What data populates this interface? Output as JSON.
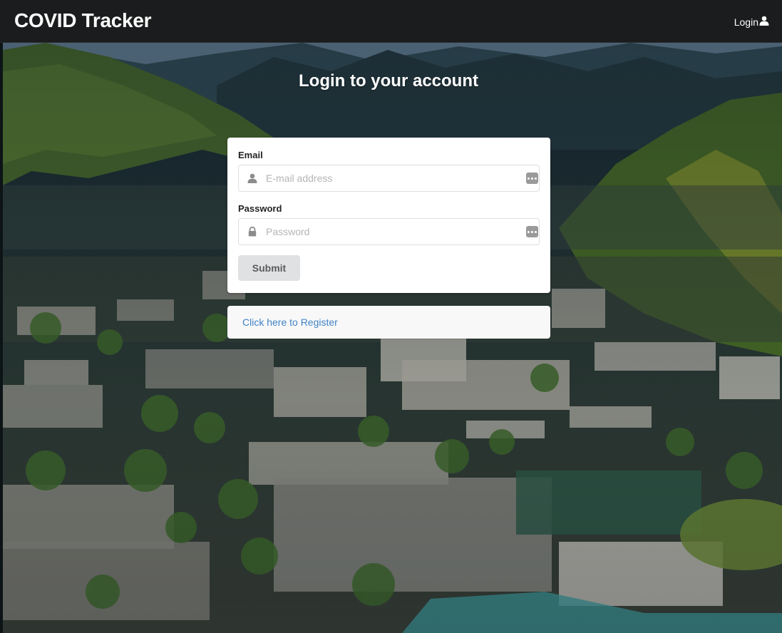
{
  "navbar": {
    "brand": "COVID Tracker",
    "login_label": "Login"
  },
  "page": {
    "title": "Login to your account"
  },
  "form": {
    "email_label": "Email",
    "email_placeholder": "E-mail address",
    "email_value": "",
    "password_label": "Password",
    "password_placeholder": "Password",
    "password_value": "",
    "submit_label": "Submit"
  },
  "register": {
    "link_text": "Click here to Register"
  },
  "icons": {
    "nav_login": "user-icon",
    "email": "user-icon",
    "password": "lock-icon",
    "field_trailing": "password-manager-icon"
  },
  "colors": {
    "navbar_bg": "#1b1c1d",
    "link": "#4183c4",
    "button_bg": "#e0e1e2"
  }
}
